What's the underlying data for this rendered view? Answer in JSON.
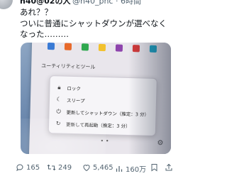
{
  "tweet": {
    "author_name": "h40@02の人",
    "author_handle": "@h40_pnc · 6時間",
    "text": "あれ？？\nついに普通にシャットダウンが選べなくなった………"
  },
  "photo": {
    "section_label": "ユーティリティとツール",
    "menu": [
      {
        "icon": "lock-icon",
        "label": "ロック"
      },
      {
        "icon": "sleep-icon",
        "label": "スリープ"
      },
      {
        "icon": "update-shutdown-icon",
        "label": "更新してシャットダウン（推定：3 分）"
      },
      {
        "icon": "update-restart-icon",
        "label": "更新して再起動（推定：3 分）"
      }
    ],
    "tile_colors": [
      "#3a7bd5",
      "#e86a2b",
      "#2fa84f",
      "#f2c12e",
      "#8e44ad",
      "#d63a3a",
      "#1ca3c4"
    ]
  },
  "actions": {
    "replies": "165",
    "retweets": "249",
    "likes": "5,465",
    "views": "160万"
  },
  "colors": {
    "text": "#0f1419",
    "secondary": "#536471"
  }
}
